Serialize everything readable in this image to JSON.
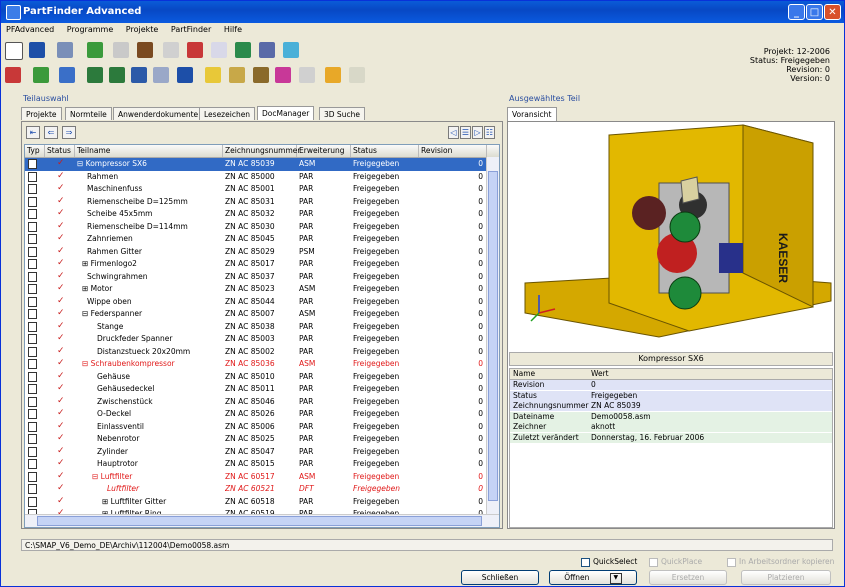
{
  "window": {
    "title": "PartFinder Advanced"
  },
  "menu": [
    "PFAdvanced",
    "Programme",
    "Projekte",
    "PartFinder",
    "Hilfe"
  ],
  "project_info": {
    "projekt": "Projekt: 12-2006",
    "status": "Status: Freigegeben",
    "revision": "Revision: 0",
    "version": "Version: 0"
  },
  "left_section": {
    "label": "Teilauswahl",
    "tabs": [
      "Projekte",
      "Normteile",
      "Anwenderdokumente",
      "Lesezeichen",
      "DocManager",
      "3D Suche"
    ],
    "active_tab": "DocManager"
  },
  "grid": {
    "columns": [
      "Typ",
      "Status",
      "Teilname",
      "Zeichnungsnummer",
      "Erweiterung",
      "Status",
      "Revision"
    ],
    "rows": [
      {
        "name": "⊟ Kompressor SX6",
        "nr": "ZN AC 85039",
        "ext": "ASM",
        "status": "Freigegeben",
        "rev": "0",
        "indent": 0,
        "sel": true
      },
      {
        "name": "Rahmen",
        "nr": "ZN AC 85000",
        "ext": "PAR",
        "status": "Freigegeben",
        "rev": "0",
        "indent": 1
      },
      {
        "name": "Maschinenfuss",
        "nr": "ZN AC 85001",
        "ext": "PAR",
        "status": "Freigegeben",
        "rev": "0",
        "indent": 1
      },
      {
        "name": "Riemenscheibe D=125mm",
        "nr": "ZN AC 85031",
        "ext": "PAR",
        "status": "Freigegeben",
        "rev": "0",
        "indent": 1
      },
      {
        "name": "Scheibe 45x5mm",
        "nr": "ZN AC 85032",
        "ext": "PAR",
        "status": "Freigegeben",
        "rev": "0",
        "indent": 1
      },
      {
        "name": "Riemenscheibe D=114mm",
        "nr": "ZN AC 85030",
        "ext": "PAR",
        "status": "Freigegeben",
        "rev": "0",
        "indent": 1
      },
      {
        "name": "Zahnriemen",
        "nr": "ZN AC 85045",
        "ext": "PAR",
        "status": "Freigegeben",
        "rev": "0",
        "indent": 1
      },
      {
        "name": "Rahmen Gitter",
        "nr": "ZN AC 85029",
        "ext": "PSM",
        "status": "Freigegeben",
        "rev": "0",
        "indent": 1
      },
      {
        "name": "⊞ Firmenlogo2",
        "nr": "ZN AC 85017",
        "ext": "PAR",
        "status": "Freigegeben",
        "rev": "0",
        "indent": 0.5
      },
      {
        "name": "Schwingrahmen",
        "nr": "ZN AC 85037",
        "ext": "PAR",
        "status": "Freigegeben",
        "rev": "0",
        "indent": 1
      },
      {
        "name": "⊞ Motor",
        "nr": "ZN AC 85023",
        "ext": "ASM",
        "status": "Freigegeben",
        "rev": "0",
        "indent": 0.5
      },
      {
        "name": "Wippe oben",
        "nr": "ZN AC 85044",
        "ext": "PAR",
        "status": "Freigegeben",
        "rev": "0",
        "indent": 1
      },
      {
        "name": "⊟ Federspanner",
        "nr": "ZN AC 85007",
        "ext": "ASM",
        "status": "Freigegeben",
        "rev": "0",
        "indent": 0.5
      },
      {
        "name": "Stange",
        "nr": "ZN AC 85038",
        "ext": "PAR",
        "status": "Freigegeben",
        "rev": "0",
        "indent": 2
      },
      {
        "name": "Druckfeder Spanner",
        "nr": "ZN AC 85003",
        "ext": "PAR",
        "status": "Freigegeben",
        "rev": "0",
        "indent": 2
      },
      {
        "name": "Distanzstueck 20x20mm",
        "nr": "ZN AC 85002",
        "ext": "PAR",
        "status": "Freigegeben",
        "rev": "0",
        "indent": 2
      },
      {
        "name": "⊟ Schraubenkompressor",
        "nr": "ZN AC 85036",
        "ext": "ASM",
        "status": "Freigegeben",
        "rev": "0",
        "indent": 0.5,
        "red": true
      },
      {
        "name": "Gehäuse",
        "nr": "ZN AC 85010",
        "ext": "PAR",
        "status": "Freigegeben",
        "rev": "0",
        "indent": 2
      },
      {
        "name": "Gehäusedeckel",
        "nr": "ZN AC 85011",
        "ext": "PAR",
        "status": "Freigegeben",
        "rev": "0",
        "indent": 2
      },
      {
        "name": "Zwischenstück",
        "nr": "ZN AC 85046",
        "ext": "PAR",
        "status": "Freigegeben",
        "rev": "0",
        "indent": 2
      },
      {
        "name": "O-Deckel",
        "nr": "ZN AC 85026",
        "ext": "PAR",
        "status": "Freigegeben",
        "rev": "0",
        "indent": 2
      },
      {
        "name": "Einlassventil",
        "nr": "ZN AC 85006",
        "ext": "PAR",
        "status": "Freigegeben",
        "rev": "0",
        "indent": 2
      },
      {
        "name": "Nebenrotor",
        "nr": "ZN AC 85025",
        "ext": "PAR",
        "status": "Freigegeben",
        "rev": "0",
        "indent": 2
      },
      {
        "name": "Zylinder",
        "nr": "ZN AC 85047",
        "ext": "PAR",
        "status": "Freigegeben",
        "rev": "0",
        "indent": 2
      },
      {
        "name": "Hauptrotor",
        "nr": "ZN AC 85015",
        "ext": "PAR",
        "status": "Freigegeben",
        "rev": "0",
        "indent": 2
      },
      {
        "name": "⊟ Luftfilter",
        "nr": "ZN AC 60517",
        "ext": "ASM",
        "status": "Freigegeben",
        "rev": "0",
        "indent": 1.5,
        "red": true
      },
      {
        "name": "Luftfilter",
        "nr": "ZN AC 60521",
        "ext": "DFT",
        "status": "Freigegeben",
        "rev": "0",
        "indent": 3,
        "red": true,
        "italic": true
      },
      {
        "name": "⊞ Luftfilter Gitter",
        "nr": "ZN AC 60518",
        "ext": "PAR",
        "status": "Freigegeben",
        "rev": "0",
        "indent": 2.5
      },
      {
        "name": "⊞ Luftfilter Ring",
        "nr": "ZN AC 60519",
        "ext": "PAR",
        "status": "Freigegeben",
        "rev": "0",
        "indent": 2.5
      }
    ]
  },
  "right_section": {
    "label": "Ausgewähltes Teil",
    "tab": "Voransicht",
    "caption": "Kompressor SX6",
    "brand_text": "KAESER"
  },
  "properties": {
    "header": [
      "Name",
      "Wert"
    ],
    "rows": [
      {
        "name": "Revision",
        "value": "0",
        "bg": "#dfe3f6"
      },
      {
        "name": "Status",
        "value": "Freigegeben",
        "bg": "#dfe3f6"
      },
      {
        "name": "Zeichnungsnummer",
        "value": "ZN AC 85039",
        "bg": "#dfe3f6"
      },
      {
        "name": "Dateiname",
        "value": "Demo0058.asm",
        "bg": "#e4f2e4"
      },
      {
        "name": "Zeichner",
        "value": "aknott",
        "bg": "#e4f2e4"
      },
      {
        "name": "Zuletzt verändert",
        "value": "Donnerstag, 16. Februar 2006",
        "bg": "#e4f2e4"
      }
    ]
  },
  "path": "C:\\SMAP_V6_Demo_DE\\Archiv\\112004\\Demo0058.asm",
  "checkboxes": {
    "quickselect": "QuickSelect",
    "quickplace": "QuickPlace",
    "copy": "In Arbeitsordner kopieren"
  },
  "buttons": {
    "close": "Schließen",
    "open": "Öffnen",
    "replace": "Ersetzen",
    "place": "Platzieren"
  }
}
